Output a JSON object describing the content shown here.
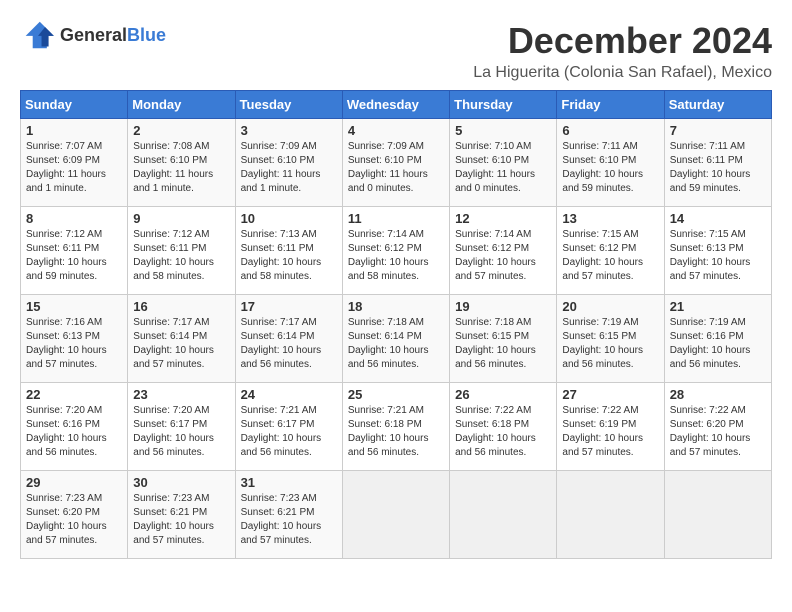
{
  "logo": {
    "general": "General",
    "blue": "Blue"
  },
  "header": {
    "month_year": "December 2024",
    "location": "La Higuerita (Colonia San Rafael), Mexico"
  },
  "weekdays": [
    "Sunday",
    "Monday",
    "Tuesday",
    "Wednesday",
    "Thursday",
    "Friday",
    "Saturday"
  ],
  "weeks": [
    [
      {
        "day": "1",
        "sunrise": "7:07 AM",
        "sunset": "6:09 PM",
        "daylight": "11 hours and 1 minute."
      },
      {
        "day": "2",
        "sunrise": "7:08 AM",
        "sunset": "6:10 PM",
        "daylight": "11 hours and 1 minute."
      },
      {
        "day": "3",
        "sunrise": "7:09 AM",
        "sunset": "6:10 PM",
        "daylight": "11 hours and 1 minute."
      },
      {
        "day": "4",
        "sunrise": "7:09 AM",
        "sunset": "6:10 PM",
        "daylight": "11 hours and 0 minutes."
      },
      {
        "day": "5",
        "sunrise": "7:10 AM",
        "sunset": "6:10 PM",
        "daylight": "11 hours and 0 minutes."
      },
      {
        "day": "6",
        "sunrise": "7:11 AM",
        "sunset": "6:10 PM",
        "daylight": "10 hours and 59 minutes."
      },
      {
        "day": "7",
        "sunrise": "7:11 AM",
        "sunset": "6:11 PM",
        "daylight": "10 hours and 59 minutes."
      }
    ],
    [
      {
        "day": "8",
        "sunrise": "7:12 AM",
        "sunset": "6:11 PM",
        "daylight": "10 hours and 59 minutes."
      },
      {
        "day": "9",
        "sunrise": "7:12 AM",
        "sunset": "6:11 PM",
        "daylight": "10 hours and 58 minutes."
      },
      {
        "day": "10",
        "sunrise": "7:13 AM",
        "sunset": "6:11 PM",
        "daylight": "10 hours and 58 minutes."
      },
      {
        "day": "11",
        "sunrise": "7:14 AM",
        "sunset": "6:12 PM",
        "daylight": "10 hours and 58 minutes."
      },
      {
        "day": "12",
        "sunrise": "7:14 AM",
        "sunset": "6:12 PM",
        "daylight": "10 hours and 57 minutes."
      },
      {
        "day": "13",
        "sunrise": "7:15 AM",
        "sunset": "6:12 PM",
        "daylight": "10 hours and 57 minutes."
      },
      {
        "day": "14",
        "sunrise": "7:15 AM",
        "sunset": "6:13 PM",
        "daylight": "10 hours and 57 minutes."
      }
    ],
    [
      {
        "day": "15",
        "sunrise": "7:16 AM",
        "sunset": "6:13 PM",
        "daylight": "10 hours and 57 minutes."
      },
      {
        "day": "16",
        "sunrise": "7:17 AM",
        "sunset": "6:14 PM",
        "daylight": "10 hours and 57 minutes."
      },
      {
        "day": "17",
        "sunrise": "7:17 AM",
        "sunset": "6:14 PM",
        "daylight": "10 hours and 56 minutes."
      },
      {
        "day": "18",
        "sunrise": "7:18 AM",
        "sunset": "6:14 PM",
        "daylight": "10 hours and 56 minutes."
      },
      {
        "day": "19",
        "sunrise": "7:18 AM",
        "sunset": "6:15 PM",
        "daylight": "10 hours and 56 minutes."
      },
      {
        "day": "20",
        "sunrise": "7:19 AM",
        "sunset": "6:15 PM",
        "daylight": "10 hours and 56 minutes."
      },
      {
        "day": "21",
        "sunrise": "7:19 AM",
        "sunset": "6:16 PM",
        "daylight": "10 hours and 56 minutes."
      }
    ],
    [
      {
        "day": "22",
        "sunrise": "7:20 AM",
        "sunset": "6:16 PM",
        "daylight": "10 hours and 56 minutes."
      },
      {
        "day": "23",
        "sunrise": "7:20 AM",
        "sunset": "6:17 PM",
        "daylight": "10 hours and 56 minutes."
      },
      {
        "day": "24",
        "sunrise": "7:21 AM",
        "sunset": "6:17 PM",
        "daylight": "10 hours and 56 minutes."
      },
      {
        "day": "25",
        "sunrise": "7:21 AM",
        "sunset": "6:18 PM",
        "daylight": "10 hours and 56 minutes."
      },
      {
        "day": "26",
        "sunrise": "7:22 AM",
        "sunset": "6:18 PM",
        "daylight": "10 hours and 56 minutes."
      },
      {
        "day": "27",
        "sunrise": "7:22 AM",
        "sunset": "6:19 PM",
        "daylight": "10 hours and 57 minutes."
      },
      {
        "day": "28",
        "sunrise": "7:22 AM",
        "sunset": "6:20 PM",
        "daylight": "10 hours and 57 minutes."
      }
    ],
    [
      {
        "day": "29",
        "sunrise": "7:23 AM",
        "sunset": "6:20 PM",
        "daylight": "10 hours and 57 minutes."
      },
      {
        "day": "30",
        "sunrise": "7:23 AM",
        "sunset": "6:21 PM",
        "daylight": "10 hours and 57 minutes."
      },
      {
        "day": "31",
        "sunrise": "7:23 AM",
        "sunset": "6:21 PM",
        "daylight": "10 hours and 57 minutes."
      },
      null,
      null,
      null,
      null
    ]
  ],
  "labels": {
    "sunrise": "Sunrise:",
    "sunset": "Sunset:",
    "daylight": "Daylight:"
  }
}
